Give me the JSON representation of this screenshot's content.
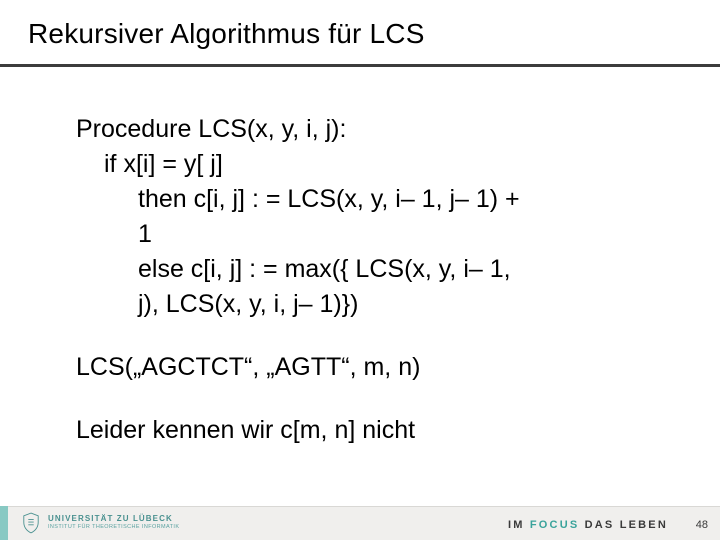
{
  "title": "Rekursiver Algorithmus für LCS",
  "body": {
    "proc_head": "Procedure LCS(x, y, i, j):",
    "if_line": "if x[i] = y[ j]",
    "then_line": "then c[i, j] : = LCS(x, y, i– 1, j– 1) +",
    "then_one": "1",
    "else_line": "else c[i, j] : = max({  LCS(x, y, i– 1,",
    "else_cont": "j),      LCS(x, y, i, j– 1)})",
    "call_line": "LCS(„AGCTCT“, „AGTT“, m, n)",
    "note_line": "Leider kennen wir c[m, n] nicht"
  },
  "footer": {
    "uni_name": "UNIVERSITÄT ZU LÜBECK",
    "uni_sub": "INSTITUT FÜR THEORETISCHE INFORMATIK",
    "motto_pre": "IM ",
    "motto_accent": "FOCUS",
    "motto_post": " DAS LEBEN",
    "page": "48"
  }
}
